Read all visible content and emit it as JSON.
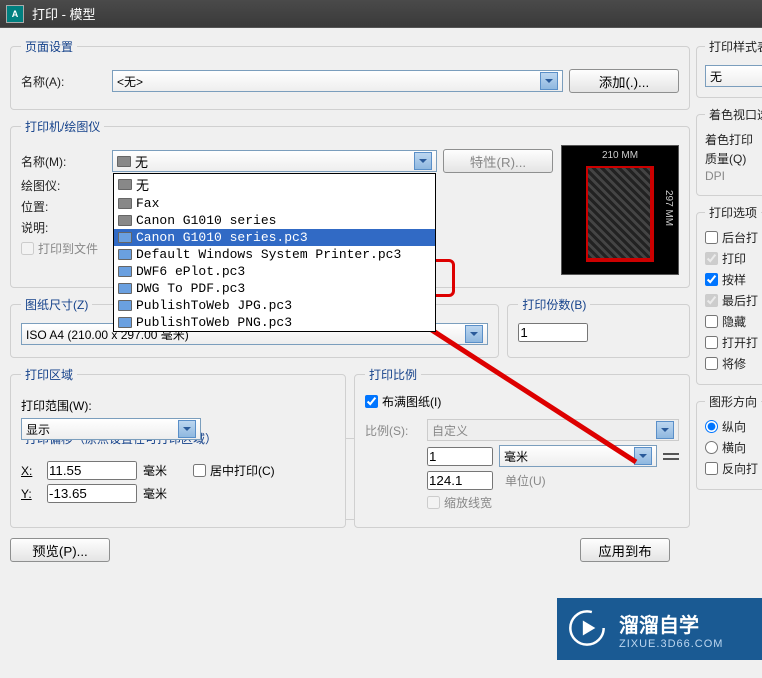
{
  "title": "打印 - 模型",
  "appicon_text": "A",
  "pageSetup": {
    "legend": "页面设置",
    "name_label": "名称(A):",
    "name_value": "<无>",
    "add_btn": "添加(.)..."
  },
  "printer": {
    "legend": "打印机/绘图仪",
    "name_label": "名称(M):",
    "name_value": "无",
    "props_btn": "特性(R)...",
    "plotter_label": "绘图仪:",
    "where_label": "位置:",
    "desc_label": "说明:",
    "to_file_label": "打印到文件",
    "preview_top": "210 MM",
    "preview_side": "297 MM",
    "dropdown_options": [
      {
        "icon": "printer",
        "text": "无"
      },
      {
        "icon": "printer",
        "text": "Fax"
      },
      {
        "icon": "printer",
        "text": "Canon G1010 series"
      },
      {
        "icon": "plotter",
        "text": "Canon G1010 series.pc3",
        "selected": true
      },
      {
        "icon": "plotter",
        "text": "Default Windows System Printer.pc3"
      },
      {
        "icon": "plotter",
        "text": "DWF6 ePlot.pc3"
      },
      {
        "icon": "plotter",
        "text": "DWG To PDF.pc3"
      },
      {
        "icon": "plotter",
        "text": "PublishToWeb JPG.pc3"
      },
      {
        "icon": "plotter",
        "text": "PublishToWeb PNG.pc3"
      }
    ]
  },
  "paperSize": {
    "legend": "图纸尺寸(Z)",
    "value": "ISO A4 (210.00 x 297.00 毫米)"
  },
  "copies": {
    "legend": "打印份数(B)",
    "value": "1"
  },
  "printArea": {
    "legend": "打印区域",
    "range_label": "打印范围(W):",
    "range_value": "显示"
  },
  "scale": {
    "legend": "打印比例",
    "fit_label": "布满图纸(I)",
    "fit_checked": true,
    "scale_label": "比例(S):",
    "scale_value": "自定义",
    "num_value": "1",
    "unit_value": "毫米",
    "denom_value": "124.1",
    "unit2_label": "单位(U)",
    "scale_lw_label": "缩放线宽"
  },
  "offset": {
    "legend": "打印偏移（原点设置在可打印区域）",
    "x_label": "X:",
    "x_value": "11.55",
    "y_label": "Y:",
    "y_value": "-13.65",
    "mm1": "毫米",
    "mm2": "毫米",
    "center_label": "居中打印(C)"
  },
  "styleTable": {
    "legend": "打印样式表",
    "value": "无"
  },
  "shadeViewport": {
    "legend": "着色视口选项",
    "shade_label": "着色打印",
    "quality_label": "质量(Q)",
    "dpi_label": "DPI"
  },
  "printOptions": {
    "legend": "打印选项",
    "items": [
      {
        "label": "后台打",
        "checked": false,
        "disabled": false
      },
      {
        "label": "打印",
        "checked": true,
        "disabled": true
      },
      {
        "label": "按样",
        "checked": true,
        "disabled": false
      },
      {
        "label": "最后打",
        "checked": true,
        "disabled": true
      },
      {
        "label": "隐藏",
        "checked": false,
        "disabled": false
      },
      {
        "label": "打开打",
        "checked": false,
        "disabled": false
      },
      {
        "label": "将修",
        "checked": false,
        "disabled": false
      }
    ]
  },
  "orientation": {
    "legend": "图形方向",
    "portrait": "纵向",
    "landscape": "横向",
    "reverse": "反向打"
  },
  "footer": {
    "preview_btn": "预览(P)...",
    "apply_btn": "应用到布"
  },
  "watermark": {
    "line1": "溜溜自学",
    "line2": "ZIXUE.3D66.COM"
  }
}
